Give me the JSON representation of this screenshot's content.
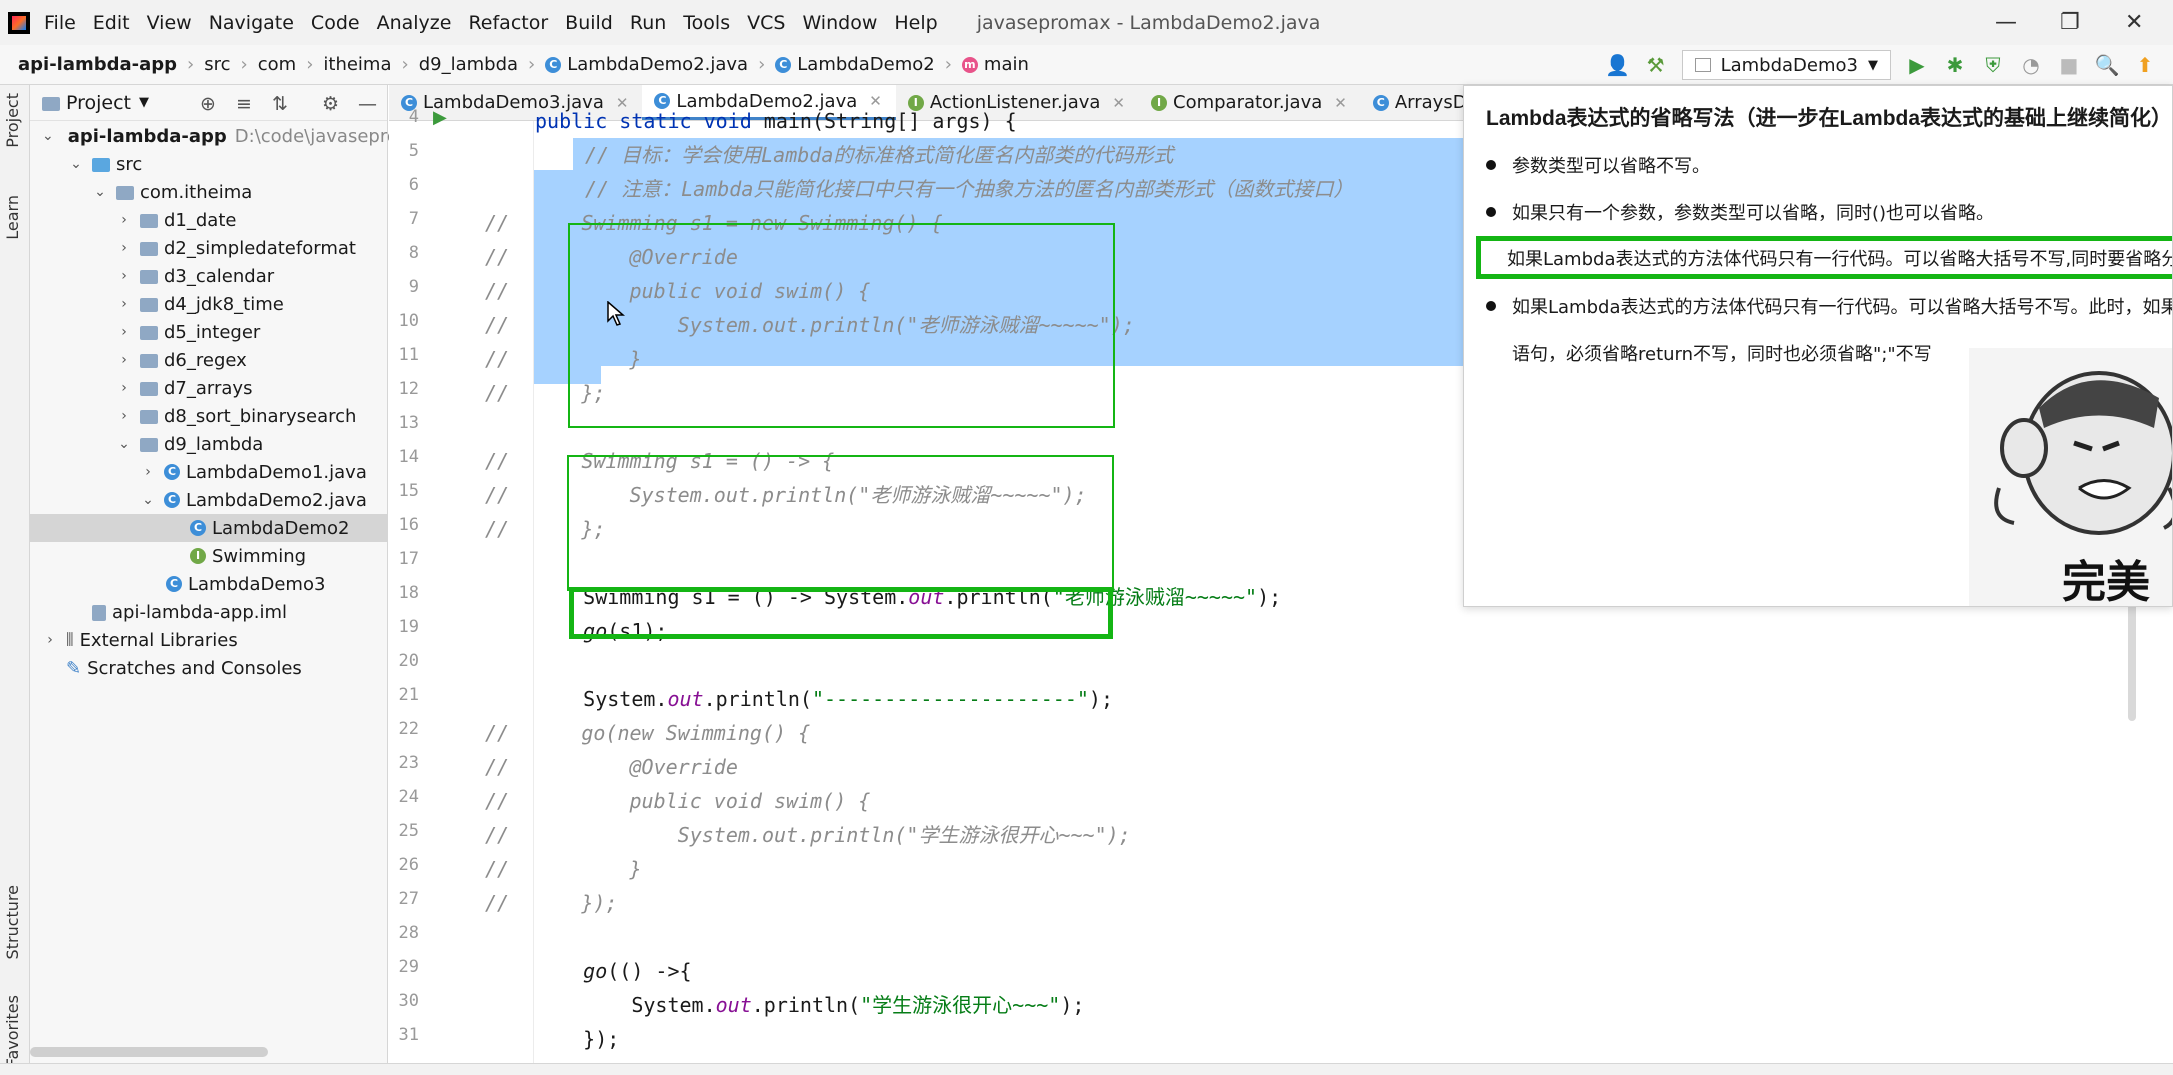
{
  "menubar": {
    "items": [
      "File",
      "Edit",
      "View",
      "Navigate",
      "Code",
      "Analyze",
      "Refactor",
      "Build",
      "Run",
      "Tools",
      "VCS",
      "Window",
      "Help"
    ],
    "title": "javasepromax - LambdaDemo2.java"
  },
  "navbar": {
    "crumbs": [
      "api-lambda-app",
      "src",
      "com",
      "itheima",
      "d9_lambda",
      "LambdaDemo2.java",
      "LambdaDemo2",
      "main"
    ],
    "run_config": "LambdaDemo3"
  },
  "leftstrip": {
    "project": "Project",
    "learn": "Learn",
    "structure": "Structure",
    "favorites": "Favorites"
  },
  "project": {
    "header": "Project",
    "tree": [
      {
        "label": "api-lambda-app",
        "extra": "D:\\code\\javasepro"
      },
      {
        "label": "src"
      },
      {
        "label": "com.itheima"
      },
      {
        "label": "d1_date"
      },
      {
        "label": "d2_simpledateformat"
      },
      {
        "label": "d3_calendar"
      },
      {
        "label": "d4_jdk8_time"
      },
      {
        "label": "d5_integer"
      },
      {
        "label": "d6_regex"
      },
      {
        "label": "d7_arrays"
      },
      {
        "label": "d8_sort_binarysearch"
      },
      {
        "label": "d9_lambda"
      },
      {
        "label": "LambdaDemo1.java"
      },
      {
        "label": "LambdaDemo2.java"
      },
      {
        "label": "LambdaDemo2"
      },
      {
        "label": "Swimming"
      },
      {
        "label": "LambdaDemo3"
      },
      {
        "label": "api-lambda-app.iml"
      },
      {
        "label": "External Libraries"
      },
      {
        "label": "Scratches and Consoles"
      }
    ]
  },
  "tabs": [
    "LambdaDemo3.java",
    "LambdaDemo2.java",
    "ActionListener.java",
    "Comparator.java",
    "ArraysDemo2.java"
  ],
  "editor": {
    "line_numbers": [
      "4",
      "5",
      "6",
      "7",
      "8",
      "9",
      "10",
      "11",
      "12",
      "13",
      "14",
      "15",
      "16",
      "17",
      "18",
      "19",
      "20",
      "21",
      "22",
      "23",
      "24",
      "25",
      "26",
      "27",
      "28",
      "29",
      "30",
      "31"
    ],
    "l4a": "public static void ",
    "l4b": "main",
    "l4c": "(String[] args) {",
    "l5": "// 目标：学会使用Lambda的标准格式简化匿名内部类的代码形式",
    "l6": "// 注意：Lambda只能简化接口中只有一个抽象方法的匿名内部类形式（函数式接口）",
    "l7": "//      Swimming s1 = new Swimming() {",
    "l8": "//          @Override",
    "l9": "//          public void swim() {",
    "l10": "//              System.out.println(\"老师游泳贼溜~~~~~\");",
    "l11": "//          }",
    "l12": "//      };",
    "l14": "//      Swimming s1 = () -> {",
    "l15": "//          System.out.println(\"老师游泳贼溜~~~~~\");",
    "l16": "//      };",
    "l18a": "    Swimming s1 = () -> System.",
    "l18b": "out",
    "l18c": ".println(",
    "l18d": "\"老师游泳贼溜~~~~~\"",
    "l18e": ");",
    "l19a": "    ",
    "l19b": "go",
    "l19c": "(s1);",
    "l21a": "    System.",
    "l21b": "out",
    "l21c": ".println(",
    "l21d": "\"---------------------\"",
    "l21e": ");",
    "l22": "//      go(new Swimming() {",
    "l23": "//          @Override",
    "l24": "//          public void swim() {",
    "l25": "//              System.out.println(\"学生游泳很开心~~~\");",
    "l26": "//          }",
    "l27": "//      });",
    "l29a": "    ",
    "l29b": "go",
    "l29c": "(() ->{",
    "l30a": "        System.",
    "l30b": "out",
    "l30c": ".println(",
    "l30d": "\"学生游泳很开心~~~\"",
    "l30e": ");",
    "l31": "    });"
  },
  "slide": {
    "title": "Lambda表达式的省略写法（进一步在Lambda表达式的基础上继续简化）",
    "bullets": [
      "参数类型可以省略不写。",
      "如果只有一个参数，参数类型可以省略，同时()也可以省略。",
      "如果Lambda表达式的方法体代码只有一行代码。可以省略大括号不写,同时要省略分号！",
      "如果Lambda表达式的方法体代码只有一行代码。可以省略大括号不写。此时，如果这行代码是return"
    ],
    "bullet4_cont": "语句，必须省略return不写，同时也必须省略\";\"不写",
    "meme_caption": "完美"
  },
  "colors": {
    "highlight": "#a6d2ff",
    "annotation_green": "#14b514",
    "keyword": "#0033b3",
    "string": "#067d17",
    "comment": "#8c8c8c"
  }
}
